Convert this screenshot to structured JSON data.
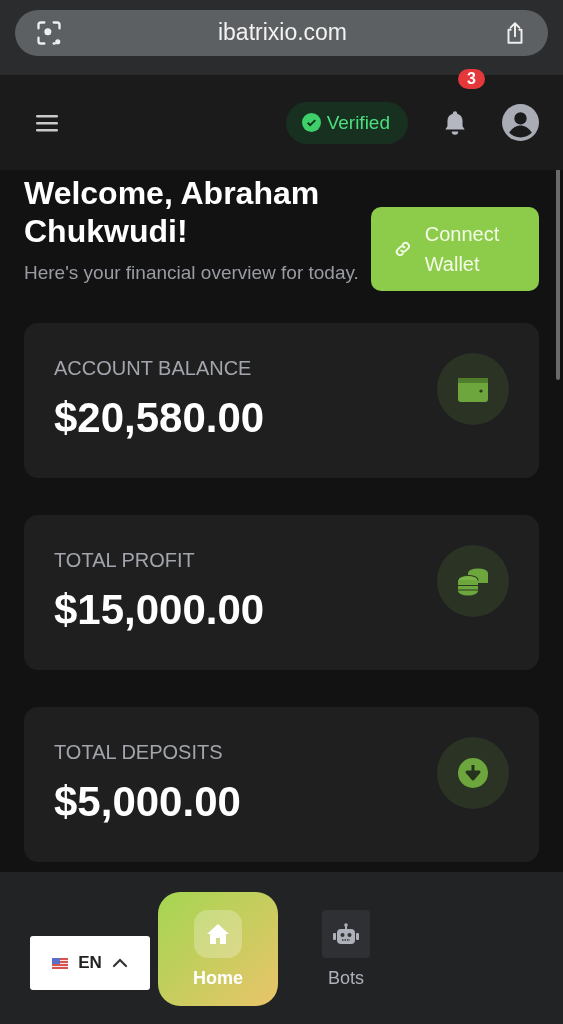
{
  "browser": {
    "url": "ibatrixio.com"
  },
  "header": {
    "verified_label": "Verified",
    "notification_count": "3"
  },
  "welcome": {
    "title": "Welcome, Abraham Chukwudi!",
    "subtitle": "Here's your financial overview for today.",
    "connect_button": "Connect Wallet"
  },
  "cards": [
    {
      "kind": "wallet",
      "label": "ACCOUNT BALANCE",
      "value": "$20,580.00"
    },
    {
      "kind": "coins",
      "label": "TOTAL PROFIT",
      "value": "$15,000.00"
    },
    {
      "kind": "deposit",
      "label": "TOTAL DEPOSITS",
      "value": "$5,000.00"
    }
  ],
  "language": {
    "code": "EN"
  },
  "nav": [
    {
      "kind": "home",
      "label": "Home",
      "selected": true
    },
    {
      "kind": "bots",
      "label": "Bots",
      "selected": false
    }
  ]
}
